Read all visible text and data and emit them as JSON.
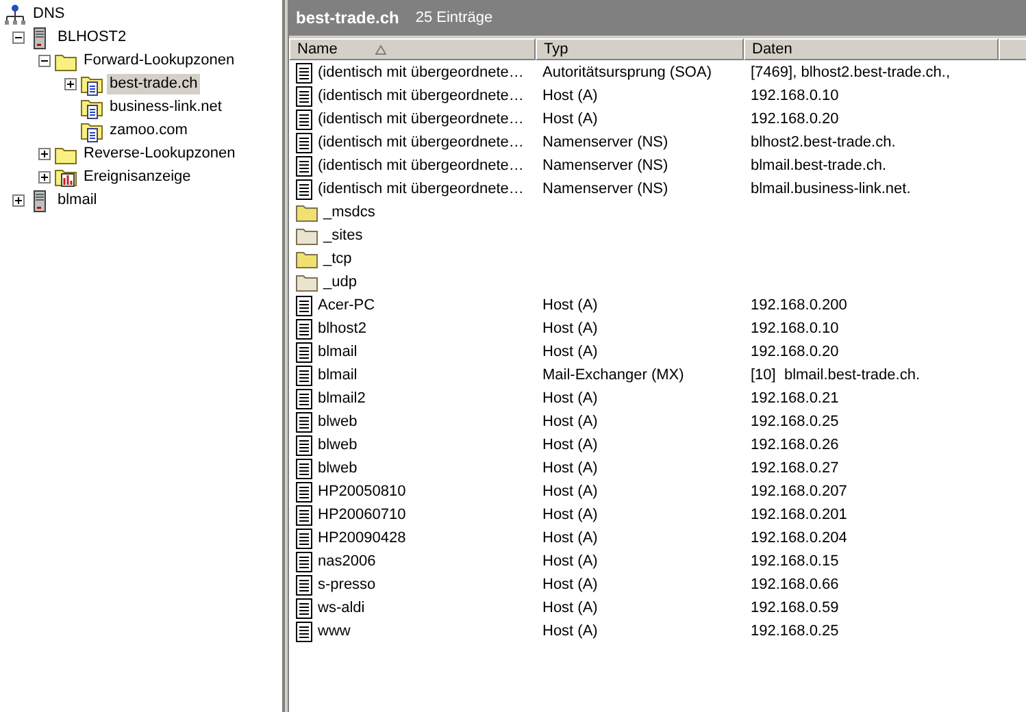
{
  "tree": [
    {
      "label": "DNS",
      "kind": "network",
      "children": [
        {
          "label": "BLHOST2",
          "kind": "server",
          "expanded": true,
          "selected": false,
          "children": [
            {
              "label": "Forward-Lookupzonen",
              "kind": "folder",
              "expanded": true,
              "selected": false,
              "children": [
                {
                  "label": "best-trade.ch",
                  "kind": "zone",
                  "expanded": false,
                  "selected": true
                },
                {
                  "label": "business-link.net",
                  "kind": "zone",
                  "selected": false
                },
                {
                  "label": "zamoo.com",
                  "kind": "zone",
                  "selected": false
                }
              ]
            },
            {
              "label": "Reverse-Lookupzonen",
              "kind": "folder",
              "expanded": false,
              "selected": false
            },
            {
              "label": "Ereignisanzeige",
              "kind": "events",
              "expanded": false,
              "selected": false
            }
          ]
        },
        {
          "label": "blmail",
          "kind": "server",
          "expanded": false,
          "selected": false
        }
      ]
    }
  ],
  "header": {
    "title": "best-trade.ch",
    "count": "25 Einträge"
  },
  "table": {
    "columns": [
      {
        "label": "Name",
        "sorted": true
      },
      {
        "label": "Typ",
        "sorted": false
      },
      {
        "label": "Daten",
        "sorted": false
      }
    ],
    "rows": [
      {
        "kind": "record",
        "name": "(identisch mit übergeordnete…",
        "type": "Autoritätsursprung (SOA)",
        "data": "[7469], blhost2.best-trade.ch.,"
      },
      {
        "kind": "record",
        "name": "(identisch mit übergeordnete…",
        "type": "Host (A)",
        "data": "192.168.0.10"
      },
      {
        "kind": "record",
        "name": "(identisch mit übergeordnete…",
        "type": "Host (A)",
        "data": "192.168.0.20"
      },
      {
        "kind": "record",
        "name": "(identisch mit übergeordnete…",
        "type": "Namenserver (NS)",
        "data": "blhost2.best-trade.ch."
      },
      {
        "kind": "record",
        "name": "(identisch mit übergeordnete…",
        "type": "Namenserver (NS)",
        "data": "blmail.best-trade.ch."
      },
      {
        "kind": "record",
        "name": "(identisch mit übergeordnete…",
        "type": "Namenserver (NS)",
        "data": "blmail.business-link.net."
      },
      {
        "kind": "folder",
        "name": "_msdcs"
      },
      {
        "kind": "folder_plain",
        "name": "_sites"
      },
      {
        "kind": "folder",
        "name": "_tcp"
      },
      {
        "kind": "folder_plain",
        "name": "_udp"
      },
      {
        "kind": "record",
        "name": "Acer-PC",
        "type": "Host (A)",
        "data": "192.168.0.200"
      },
      {
        "kind": "record",
        "name": "blhost2",
        "type": "Host (A)",
        "data": "192.168.0.10"
      },
      {
        "kind": "record",
        "name": "blmail",
        "type": "Host (A)",
        "data": "192.168.0.20"
      },
      {
        "kind": "record",
        "name": "blmail",
        "type": "Mail-Exchanger (MX)",
        "data": "[10]  blmail.best-trade.ch."
      },
      {
        "kind": "record",
        "name": "blmail2",
        "type": "Host (A)",
        "data": "192.168.0.21"
      },
      {
        "kind": "record",
        "name": "blweb",
        "type": "Host (A)",
        "data": "192.168.0.25"
      },
      {
        "kind": "record",
        "name": "blweb",
        "type": "Host (A)",
        "data": "192.168.0.26"
      },
      {
        "kind": "record",
        "name": "blweb",
        "type": "Host (A)",
        "data": "192.168.0.27"
      },
      {
        "kind": "record",
        "name": "HP20050810",
        "type": "Host (A)",
        "data": "192.168.0.207"
      },
      {
        "kind": "record",
        "name": "HP20060710",
        "type": "Host (A)",
        "data": "192.168.0.201"
      },
      {
        "kind": "record",
        "name": "HP20090428",
        "type": "Host (A)",
        "data": "192.168.0.204"
      },
      {
        "kind": "record",
        "name": "nas2006",
        "type": "Host (A)",
        "data": "192.168.0.15"
      },
      {
        "kind": "record",
        "name": "s-presso",
        "type": "Host (A)",
        "data": "192.168.0.66"
      },
      {
        "kind": "record",
        "name": "ws-aldi",
        "type": "Host (A)",
        "data": "192.168.0.59"
      },
      {
        "kind": "record",
        "name": "www",
        "type": "Host (A)",
        "data": "192.168.0.25"
      }
    ]
  }
}
